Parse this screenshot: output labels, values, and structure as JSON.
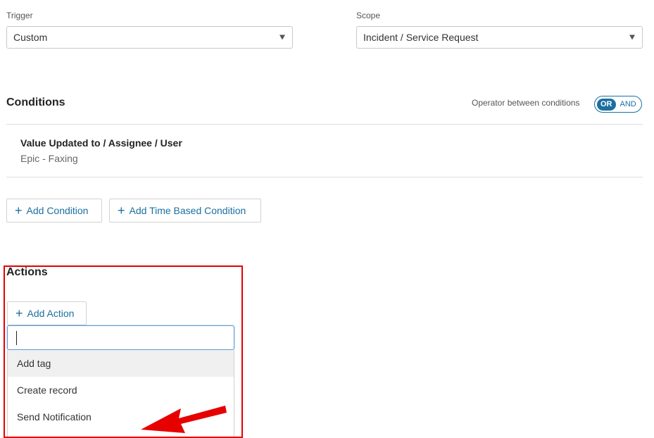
{
  "trigger": {
    "label": "Trigger",
    "value": "Custom"
  },
  "scope": {
    "label": "Scope",
    "value": "Incident / Service Request"
  },
  "conditions": {
    "title": "Conditions",
    "operator_label": "Operator between conditions",
    "operator_options": [
      "OR",
      "AND"
    ],
    "operator_selected": "OR",
    "items": [
      {
        "title": "Value Updated to / Assignee / User",
        "subtitle": "Epic - Faxing"
      }
    ],
    "add_condition_label": "Add Condition",
    "add_time_condition_label": "Add Time Based Condition"
  },
  "actions": {
    "title": "Actions",
    "add_action_label": "Add Action",
    "search_value": "",
    "menu_items": [
      "Add tag",
      "Create record",
      "Send Notification"
    ],
    "hovered_item": "Add tag"
  },
  "annotation": {
    "highlight_color": "#e60000",
    "arrow_color": "#e60000"
  },
  "accent_color": "#1b6fa0"
}
